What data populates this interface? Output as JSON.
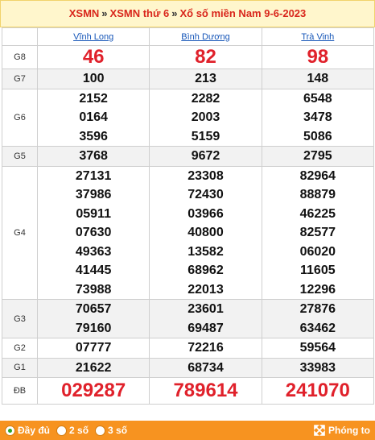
{
  "breadcrumb": {
    "items": [
      "XSMN",
      "XSMN thứ 6",
      "Xổ số miền Nam 9-6-2023"
    ],
    "separator": "»"
  },
  "provinces": [
    "Vĩnh Long",
    "Bình Dương",
    "Trà Vinh"
  ],
  "rows": [
    {
      "label": "G8",
      "style": "big",
      "values": [
        [
          "46"
        ],
        [
          "82"
        ],
        [
          "98"
        ]
      ]
    },
    {
      "label": "G7",
      "style": "num",
      "values": [
        [
          "100"
        ],
        [
          "213"
        ],
        [
          "148"
        ]
      ]
    },
    {
      "label": "G6",
      "style": "num",
      "values": [
        [
          "2152",
          "0164",
          "3596"
        ],
        [
          "2282",
          "2003",
          "5159"
        ],
        [
          "6548",
          "3478",
          "5086"
        ]
      ]
    },
    {
      "label": "G5",
      "style": "num",
      "values": [
        [
          "3768"
        ],
        [
          "9672"
        ],
        [
          "2795"
        ]
      ]
    },
    {
      "label": "G4",
      "style": "num",
      "values": [
        [
          "27131",
          "37986",
          "05911",
          "07630",
          "49363",
          "41445",
          "73988"
        ],
        [
          "23308",
          "72430",
          "03966",
          "40800",
          "13582",
          "68962",
          "22013"
        ],
        [
          "82964",
          "88879",
          "46225",
          "82577",
          "06020",
          "11605",
          "12296"
        ]
      ]
    },
    {
      "label": "G3",
      "style": "num",
      "values": [
        [
          "70657",
          "79160"
        ],
        [
          "23601",
          "69487"
        ],
        [
          "27876",
          "63462"
        ]
      ]
    },
    {
      "label": "G2",
      "style": "num",
      "values": [
        [
          "07777"
        ],
        [
          "72216"
        ],
        [
          "59564"
        ]
      ]
    },
    {
      "label": "G1",
      "style": "num",
      "values": [
        [
          "21622"
        ],
        [
          "68734"
        ],
        [
          "33983"
        ]
      ]
    },
    {
      "label": "ĐB",
      "style": "db",
      "values": [
        [
          "029287"
        ],
        [
          "789614"
        ],
        [
          "241070"
        ]
      ]
    }
  ],
  "footer": {
    "options": [
      "Đầy đủ",
      "2 số",
      "3 số"
    ],
    "selected": "Đầy đủ",
    "zoom_label": "Phóng to"
  },
  "colors": {
    "accent_red": "#e0212b",
    "link_blue": "#1656b8",
    "footer_orange": "#f79320",
    "breadcrumb_bg": "#fff6cc"
  }
}
